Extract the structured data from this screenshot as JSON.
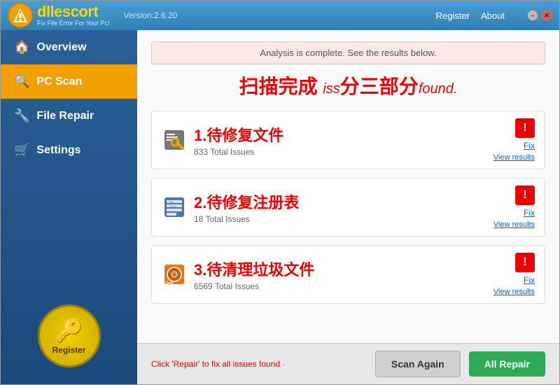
{
  "titlebar": {
    "logo_highlight": "dll",
    "logo_rest": "escort",
    "logo_sub": "Fix File Error For Your Pc!",
    "version": "Version:2.6.20",
    "register_link": "Register",
    "about_link": "About"
  },
  "window_controls": {
    "minimize": "–",
    "close": "✕"
  },
  "sidebar": {
    "items": [
      {
        "id": "overview",
        "label": "Overview",
        "icon": "🏠",
        "active": false
      },
      {
        "id": "pc-scan",
        "label": "PC Scan",
        "icon": "🔍",
        "active": true
      },
      {
        "id": "file-repair",
        "label": "File Repair",
        "icon": "🔧",
        "active": false
      },
      {
        "id": "settings",
        "label": "Settings",
        "icon": "🛒",
        "active": false
      }
    ],
    "register_badge_label": "Register"
  },
  "content": {
    "analysis_bar": "Analysis is complete. See the results below.",
    "scan_complete_title": "扫描完成 iss三部分found.",
    "issues": [
      {
        "id": "file-issues",
        "icon_type": "wrench",
        "title": "1.待修复文件",
        "count": "833 Total Issues",
        "fix_label": "Fix",
        "view_label": "View results"
      },
      {
        "id": "registry-issues",
        "icon_type": "registry",
        "title": "2.待修复注册表",
        "count": "18 Total Issues",
        "fix_label": "Fix",
        "view_label": "View results"
      },
      {
        "id": "disk-issues",
        "icon_type": "disk",
        "title": "3.待清理垃圾文件",
        "count": "6569 Total Issues",
        "fix_label": "Fix",
        "view_label": "View results"
      }
    ],
    "footer_note": "Click 'Repair' to fix all issues found",
    "btn_scan_again": "Scan Again",
    "btn_all_repair": "All Repair"
  }
}
